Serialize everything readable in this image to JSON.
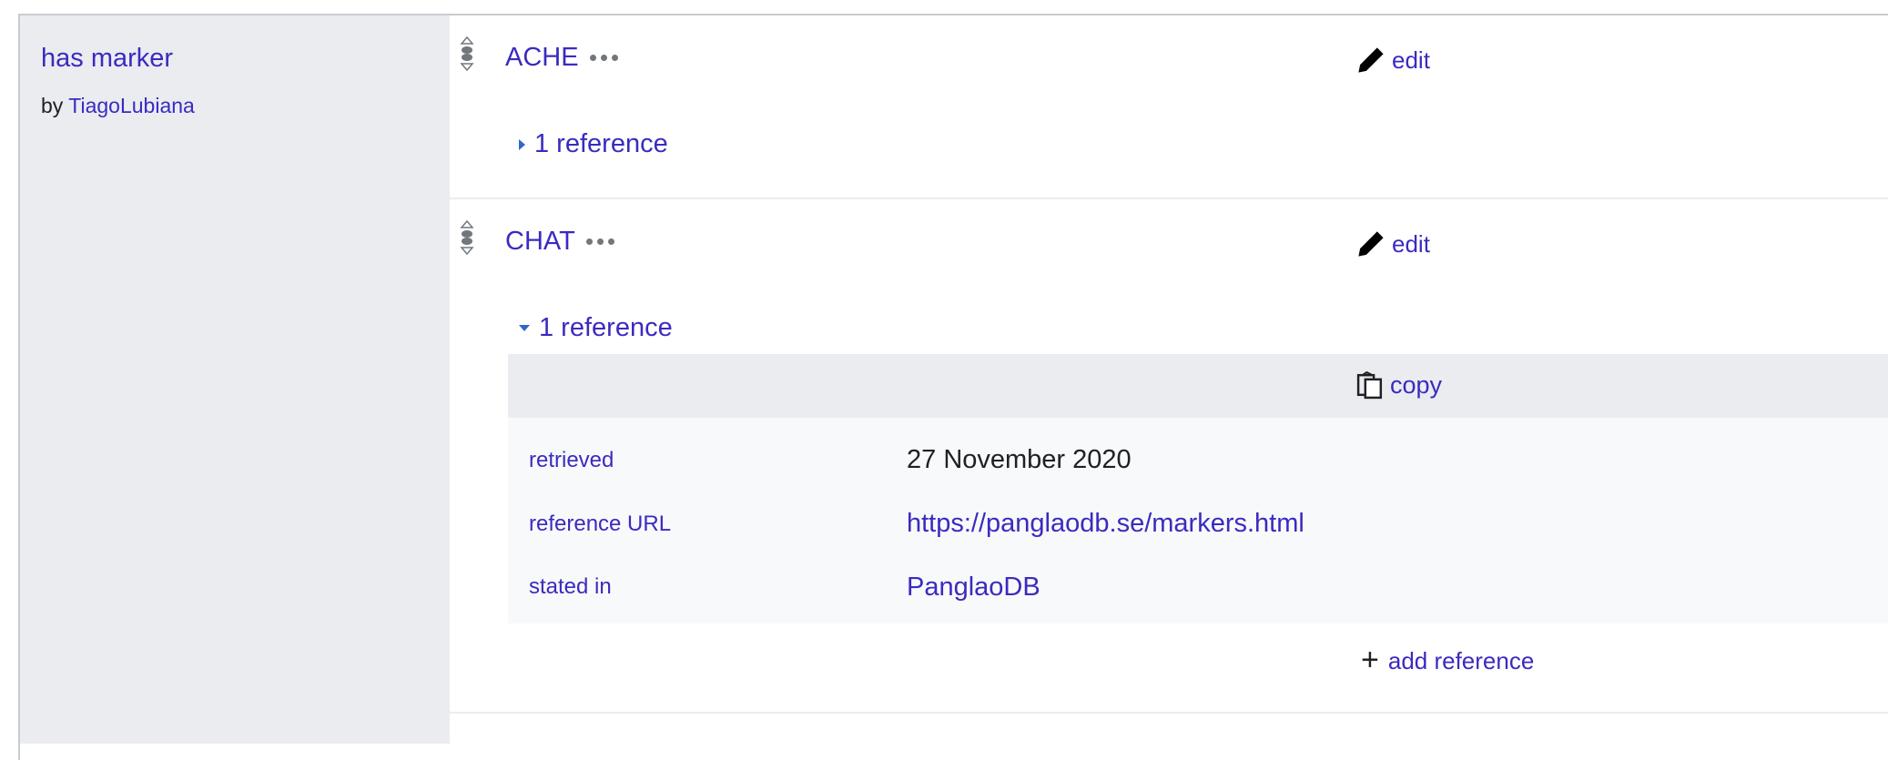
{
  "property": {
    "name": "has marker",
    "by_prefix": "by",
    "by_user": "TiagoLubiana"
  },
  "statements": [
    {
      "value": "ACHE",
      "edit_label": "edit",
      "references_label": "1 reference",
      "references_expanded": false
    },
    {
      "value": "CHAT",
      "edit_label": "edit",
      "references_label": "1 reference",
      "references_expanded": true,
      "reference": {
        "copy_label": "copy",
        "snaks": [
          {
            "property": "retrieved",
            "value": "27 November 2020",
            "is_link": false
          },
          {
            "property": "reference URL",
            "value": "https://panglaodb.se/markers.html",
            "is_link": true
          },
          {
            "property": "stated in",
            "value": "PanglaoDB",
            "is_link": true
          }
        ]
      },
      "add_reference_label": "add reference"
    }
  ],
  "colors": {
    "link": "#3a2bbf",
    "property_bg": "#eaecf0",
    "reference_bg": "#f8f9fa",
    "border": "#c8ccd1"
  },
  "icons": [
    "rank-normal-icon",
    "more-dots-icon",
    "pencil-icon",
    "expand-triangle-icon",
    "copy-icon",
    "plus-icon"
  ]
}
